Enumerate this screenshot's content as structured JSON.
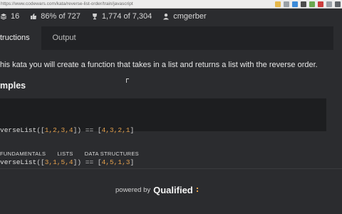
{
  "browser": {
    "url": "https://www.codewars.com/kata/reverse-list-order/train/javascript",
    "ext_colors": [
      "#e6b84a",
      "#9aa0a6",
      "#3b8ad9",
      "#4c4c4c",
      "#6aa84f",
      "#cc3d3d",
      "#9aa0a6",
      "#5f6368"
    ]
  },
  "stats": {
    "solutions_count": "16",
    "satisfaction": "86% of 727",
    "completed": "1,774 of 7,304",
    "author": "cmgerber"
  },
  "tabs": {
    "instructions": "tructions",
    "output": "Output"
  },
  "description": "his kata you will create a function that takes in a list and returns a list with the reverse order.",
  "examples_heading": "mples",
  "code": {
    "line1": {
      "fn": "verseList",
      "args": "1,2,3,4",
      "result": "4,3,2,1"
    },
    "line2": {
      "fn": "verseList",
      "args": "3,1,5,4",
      "result": "4,5,1,3"
    }
  },
  "tags": [
    "FUNDAMENTALS",
    "LISTS",
    "DATA STRUCTURES"
  ],
  "footer": {
    "powered_by": "powered by",
    "brand": "Qualified"
  },
  "colors": {
    "background": "#2b2c2f",
    "tab_bar": "#212225",
    "code_bg": "#1d1e20",
    "number": "#e5a14d"
  }
}
